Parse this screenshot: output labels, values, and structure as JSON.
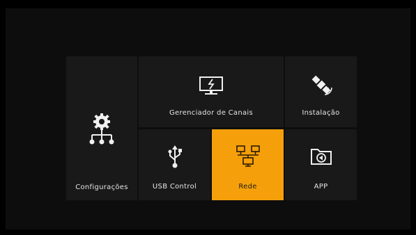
{
  "menu": {
    "tiles": [
      {
        "id": "configuracoes",
        "label": "Configurações",
        "icon": "settings-network-icon",
        "selected": false
      },
      {
        "id": "gerenciador",
        "label": "Gerenciador de Canais",
        "icon": "monitor-channels-icon",
        "selected": false
      },
      {
        "id": "instalacao",
        "label": "Instalação",
        "icon": "satellite-icon",
        "selected": false
      },
      {
        "id": "usb",
        "label": "USB Control",
        "icon": "usb-icon",
        "selected": false
      },
      {
        "id": "rede",
        "label": "Rede",
        "icon": "network-icon",
        "selected": true
      },
      {
        "id": "app",
        "label": "APP",
        "icon": "app-folder-icon",
        "selected": false
      }
    ],
    "colors": {
      "background": "#000000",
      "tile": "#191919",
      "selected": "#f5a00a",
      "text": "#e6e6e6"
    }
  }
}
